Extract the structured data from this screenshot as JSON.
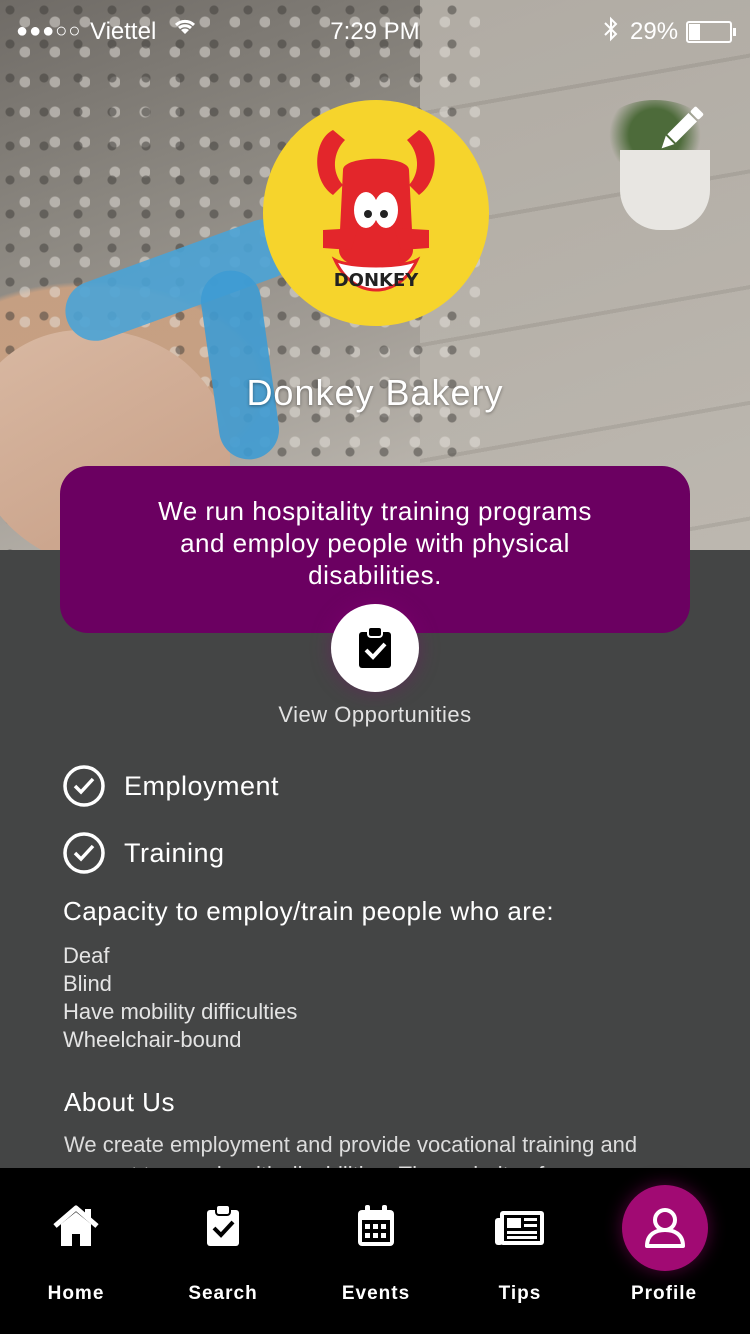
{
  "status_bar": {
    "signal": "●●●○○",
    "carrier": "Viettel",
    "time": "7:29 PM",
    "battery_percent": "29%",
    "battery_level": 0.29
  },
  "profile": {
    "name": "Donkey Bakery",
    "logo_text": "DONKEY",
    "mission": "We run hospitality training programs and employ people with physical disabilities.",
    "view_opportunities_label": "View Opportunities"
  },
  "offerings": [
    {
      "label": "Employment",
      "checked": true
    },
    {
      "label": "Training",
      "checked": true
    }
  ],
  "capacity": {
    "title": "Capacity to employ/train people who are:",
    "items": [
      "Deaf",
      "Blind",
      "Have mobility difficulties",
      "Wheelchair-bound"
    ]
  },
  "about": {
    "title": "About Us",
    "text": "We create employment and provide vocational training and support to people with disabilities. The majority of"
  },
  "tab_bar": {
    "items": [
      {
        "label": "Home",
        "icon": "home-icon"
      },
      {
        "label": "Search",
        "icon": "clipboard-check-icon"
      },
      {
        "label": "Events",
        "icon": "calendar-icon"
      },
      {
        "label": "Tips",
        "icon": "newspaper-icon"
      },
      {
        "label": "Profile",
        "icon": "user-icon",
        "active": true
      }
    ]
  },
  "colors": {
    "accent_purple": "#6b0061",
    "profile_active": "#a10a73",
    "background": "#444545",
    "logo_yellow": "#f6d42c"
  }
}
